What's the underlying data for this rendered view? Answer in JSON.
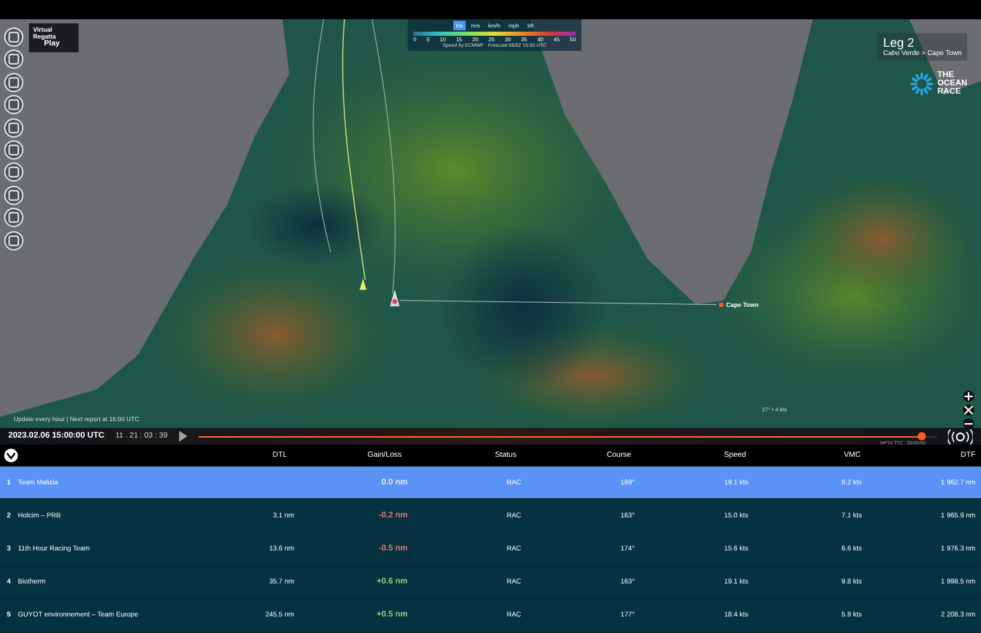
{
  "logo": {
    "line1": "Virtual",
    "line2": "Regatta",
    "line3": "Play"
  },
  "legend": {
    "units": [
      {
        "label": "kts",
        "selected": true
      },
      {
        "label": "m/s",
        "selected": false
      },
      {
        "label": "km/h",
        "selected": false
      },
      {
        "label": "mph",
        "selected": false
      },
      {
        "label": "bft",
        "selected": false
      }
    ],
    "ticks": [
      "0",
      "5",
      "10",
      "15",
      "20",
      "25",
      "30",
      "35",
      "40",
      "45",
      "50"
    ],
    "caption": "Speed by ECMWF · Forecast 06/02 15:00 UTC"
  },
  "leg": {
    "title": "Leg 2",
    "route": "Cabo Verde > Cape Town"
  },
  "brand": {
    "line1": "THE",
    "line2": "OCEAN",
    "line3": "RACE"
  },
  "map": {
    "city": "Cape Town",
    "cursor_reading": "27° • 4 kts",
    "update_note": "Update every hour | Next report at 16:00 UTC"
  },
  "timeline": {
    "datetime": "2023.02.06 15:00:00 UTC",
    "elapsed": "11 . 21 : 03 : 39",
    "level": 0.98,
    "note": "NPTA TTC : 00/00/00"
  },
  "table": {
    "columns": [
      "DTL",
      "Gain/Loss",
      "Status",
      "Course",
      "Speed",
      "VMC",
      "DTF"
    ],
    "rows": [
      {
        "rank": "1",
        "team": "Team Malizia",
        "dtl": "",
        "gain": "0.0 nm",
        "color": "#dfe8f4",
        "status": "RAC",
        "course": "169°",
        "speed": "19.1 kts",
        "vmc": "8.2 kts",
        "dtf": "1 962.7 nm",
        "selected": true
      },
      {
        "rank": "2",
        "team": "Holcim – PRB",
        "dtl": "3.1 nm",
        "gain": "-0.2 nm",
        "color": "#e8787a",
        "status": "RAC",
        "course": "163°",
        "speed": "15.0 kts",
        "vmc": "7.1 kts",
        "dtf": "1 965.9 nm",
        "selected": false
      },
      {
        "rank": "3",
        "team": "11th Hour Racing Team",
        "dtl": "13.6 nm",
        "gain": "-0.5 nm",
        "color": "#e8787a",
        "status": "RAC",
        "course": "174°",
        "speed": "15.6 kts",
        "vmc": "6.6 kts",
        "dtf": "1 976.3 nm",
        "selected": false
      },
      {
        "rank": "4",
        "team": "Biotherm",
        "dtl": "35.7 nm",
        "gain": "+0.6 nm",
        "color": "#7fd97a",
        "status": "RAC",
        "course": "163°",
        "speed": "19.1 kts",
        "vmc": "9.8 kts",
        "dtf": "1 998.5 nm",
        "selected": false
      },
      {
        "rank": "5",
        "team": "GUYOT environnement – Team Europe",
        "dtl": "245.5 nm",
        "gain": "+0.5 nm",
        "color": "#7fd97a",
        "status": "RAC",
        "course": "177°",
        "speed": "18.4 kts",
        "vmc": "5.8 kts",
        "dtf": "2 208.3 nm",
        "selected": false
      }
    ]
  }
}
